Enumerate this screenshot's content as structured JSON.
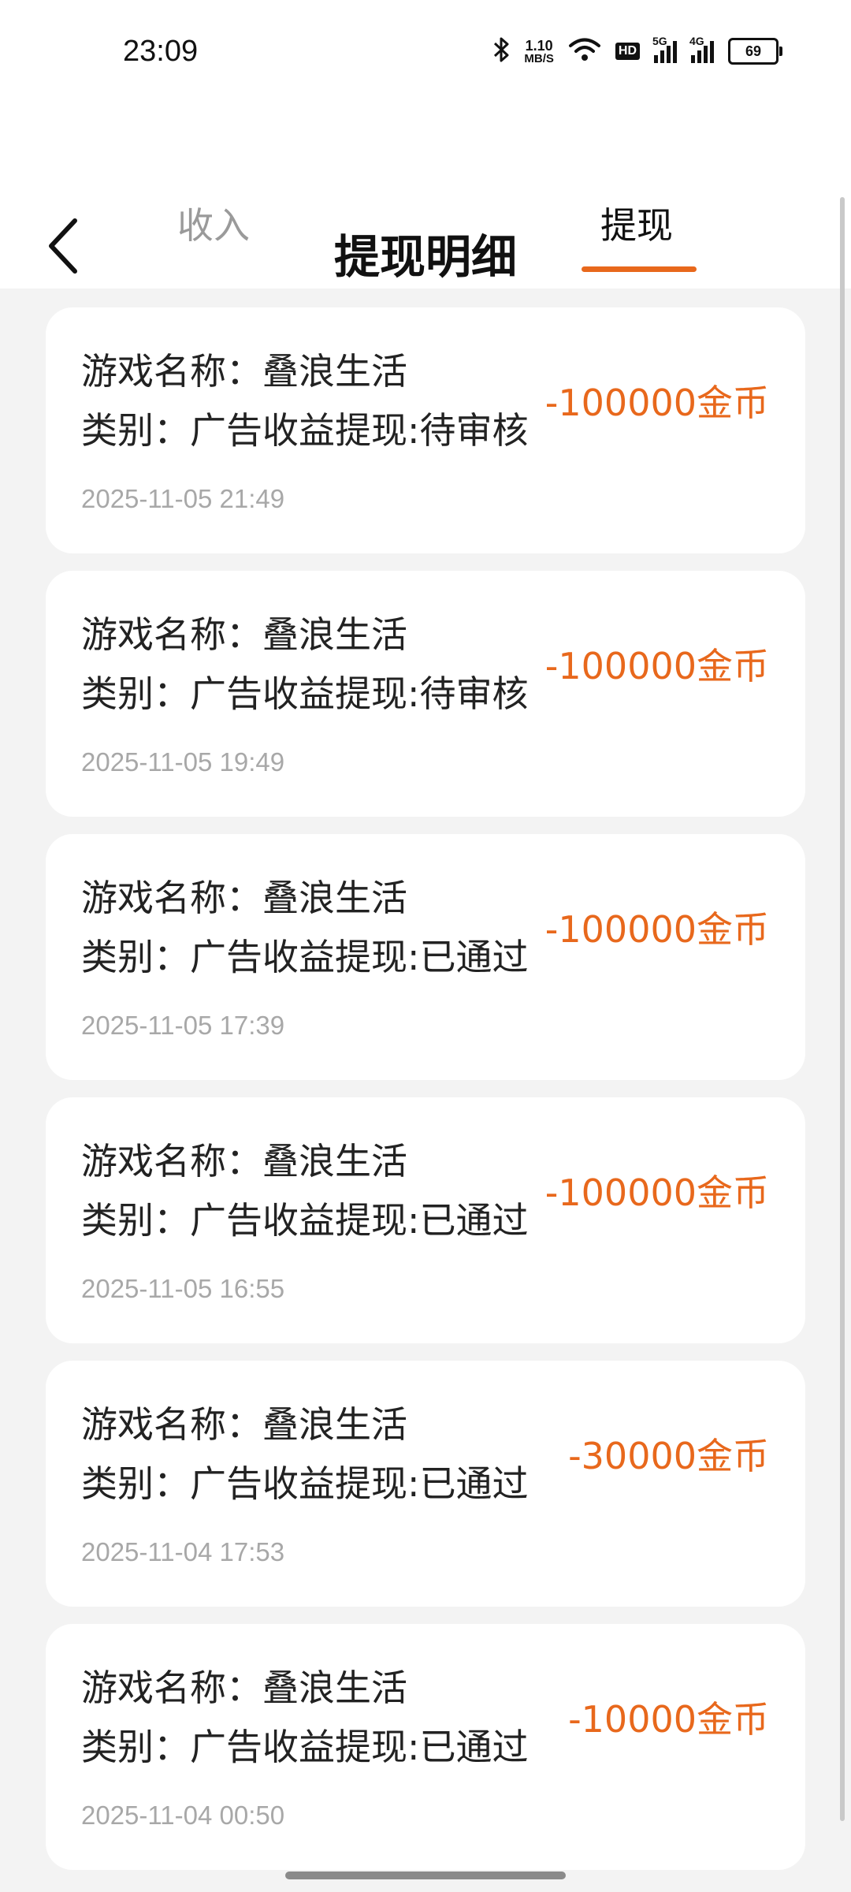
{
  "status_bar": {
    "time": "23:09",
    "speed_value": "1.10",
    "speed_unit": "MB/S",
    "hd_label": "HD",
    "net_5g": "5G",
    "net_4g": "4G",
    "battery": "69"
  },
  "header": {
    "title": "提现明细",
    "tabs": [
      {
        "label": "收入",
        "active": false
      },
      {
        "label": "提现",
        "active": true
      }
    ]
  },
  "colors": {
    "accent": "#e8681c",
    "background": "#f3f3f3",
    "card": "#ffffff",
    "muted": "#a8a8a8"
  },
  "records": [
    {
      "name": "游戏名称：叠浪生活",
      "type": "类别：广告收益提现:待审核",
      "amount": "-100000金币",
      "time": "2025-11-05 21:49"
    },
    {
      "name": "游戏名称：叠浪生活",
      "type": "类别：广告收益提现:待审核",
      "amount": "-100000金币",
      "time": "2025-11-05 19:49"
    },
    {
      "name": "游戏名称：叠浪生活",
      "type": "类别：广告收益提现:已通过",
      "amount": "-100000金币",
      "time": "2025-11-05 17:39"
    },
    {
      "name": "游戏名称：叠浪生活",
      "type": "类别：广告收益提现:已通过",
      "amount": "-100000金币",
      "time": "2025-11-05 16:55"
    },
    {
      "name": "游戏名称：叠浪生活",
      "type": "类别：广告收益提现:已通过",
      "amount": "-30000金币",
      "time": "2025-11-04 17:53"
    },
    {
      "name": "游戏名称：叠浪生活",
      "type": "类别：广告收益提现:已通过",
      "amount": "-10000金币",
      "time": "2025-11-04 00:50"
    }
  ]
}
